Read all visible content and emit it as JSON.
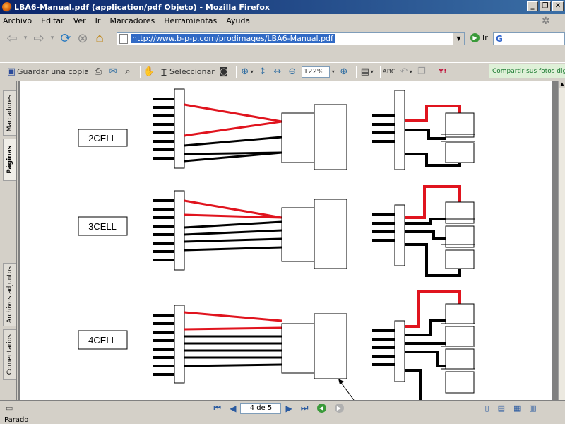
{
  "window": {
    "title": "LBA6-Manual.pdf (application/pdf Objeto) - Mozilla Firefox"
  },
  "menu": [
    "Archivo",
    "Editar",
    "Ver",
    "Ir",
    "Marcadores",
    "Herramientas",
    "Ayuda"
  ],
  "nav": {
    "url": "http://www.b-p-p.com/prodimages/LBA6-Manual.pdf",
    "go_label": "Ir",
    "search_logo": "G"
  },
  "pdf_toolbar": {
    "save_label": "Guardar una copia",
    "select_label": "Seleccionar",
    "zoom_value": "122%",
    "ad_text": "Compartir sus fotos digitales"
  },
  "side_tabs": [
    "Marcadores",
    "Páginas",
    "Archivos adjuntos",
    "Comentarios"
  ],
  "diagram": {
    "labels": [
      "2CELL",
      "3CELL",
      "4CELL"
    ]
  },
  "bottom": {
    "page_field": "4 de 5"
  },
  "status": {
    "text": "Parado"
  },
  "colors": {
    "wire_red": "#e0141e",
    "wire_black": "#000000",
    "title_bar": "#0a246a"
  }
}
